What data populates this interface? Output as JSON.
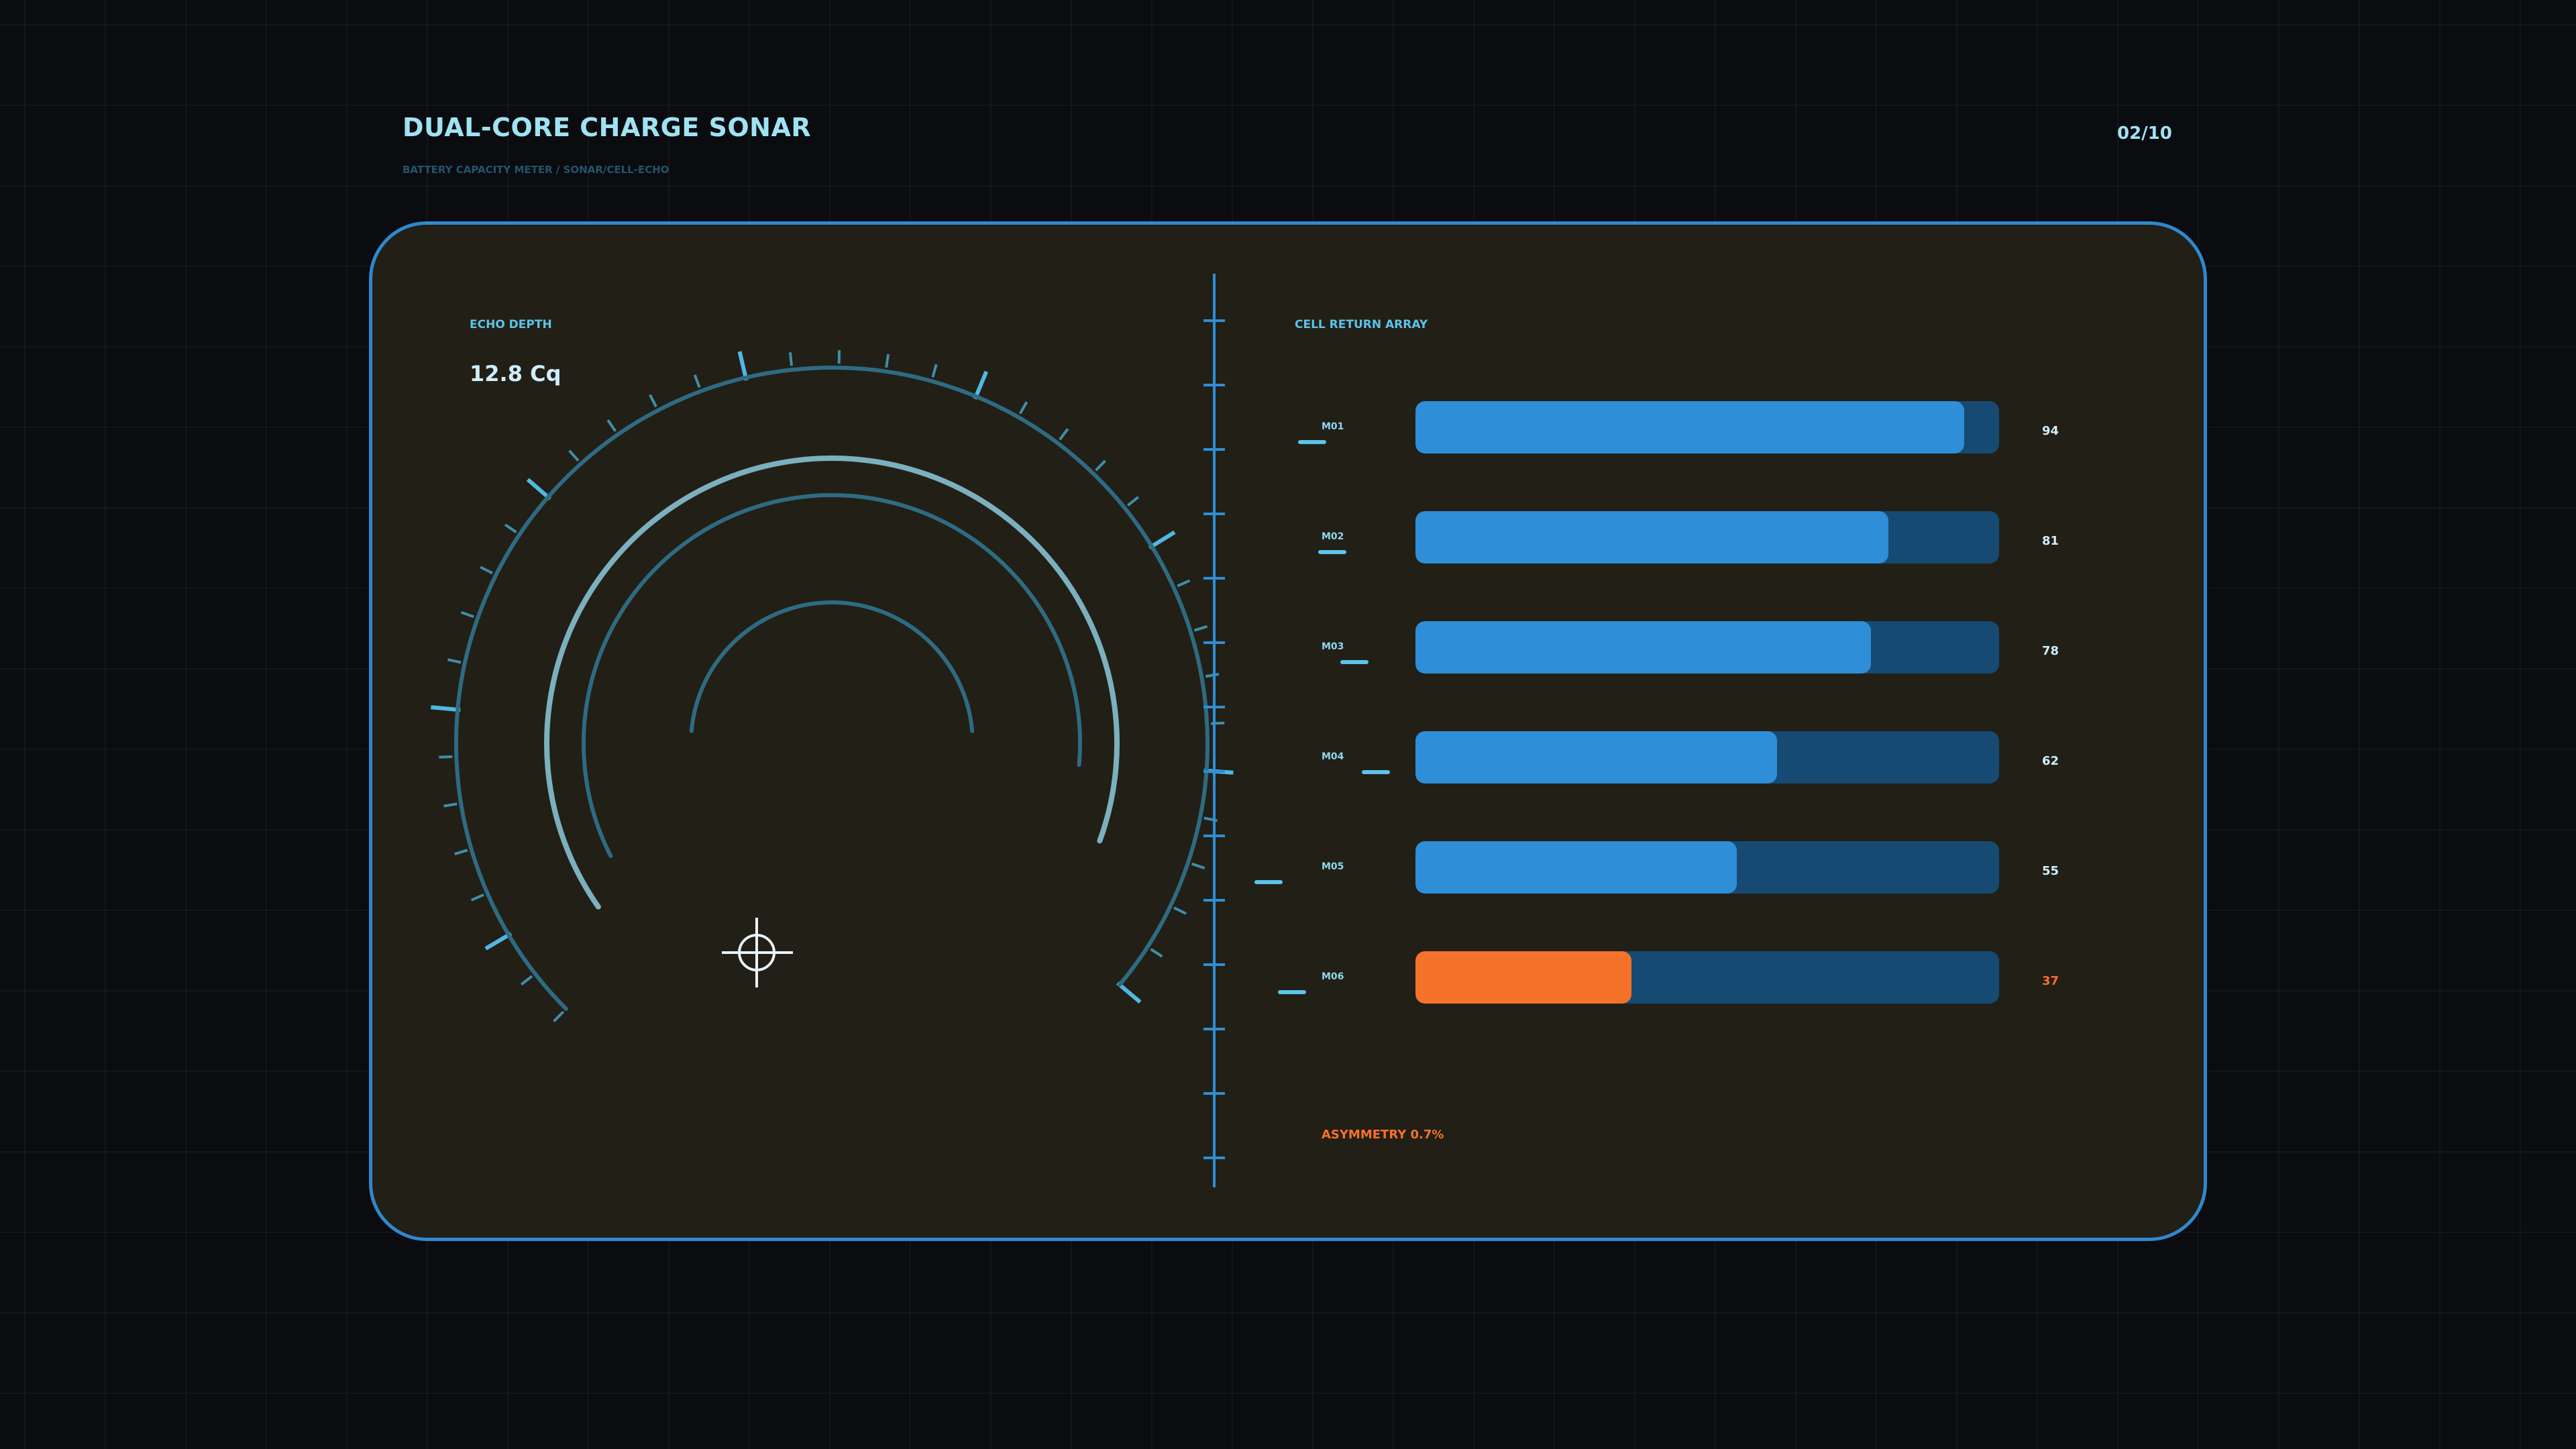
{
  "header": {
    "title": "DUAL-CORE CHARGE SONAR",
    "subtitle": "BATTERY CAPACITY METER / SONAR/CELL-ECHO",
    "page": "02/10"
  },
  "gauge": {
    "label": "ECHO DEPTH",
    "value": "12.8 Cq"
  },
  "cells": {
    "label": "CELL RETURN ARRAY",
    "rows": [
      {
        "label": "M01",
        "value": 94,
        "display": "94"
      },
      {
        "label": "M02",
        "value": 81,
        "display": "81"
      },
      {
        "label": "M03",
        "value": 78,
        "display": "78"
      },
      {
        "label": "M04",
        "value": 62,
        "display": "62"
      },
      {
        "label": "M05",
        "value": 55,
        "display": "55"
      },
      {
        "label": "M06",
        "value": 37,
        "display": "37",
        "status": "low"
      }
    ],
    "footer": "ASYMMETRY 0.7%"
  },
  "colors": {
    "panel_border": "#2f88cf",
    "bar_fill": "#2e8ed8",
    "bar_track": "#164a72",
    "warning": "#f5722b",
    "accent": "#5cc4ea"
  },
  "icons": {
    "crosshair": "crosshair-icon"
  }
}
